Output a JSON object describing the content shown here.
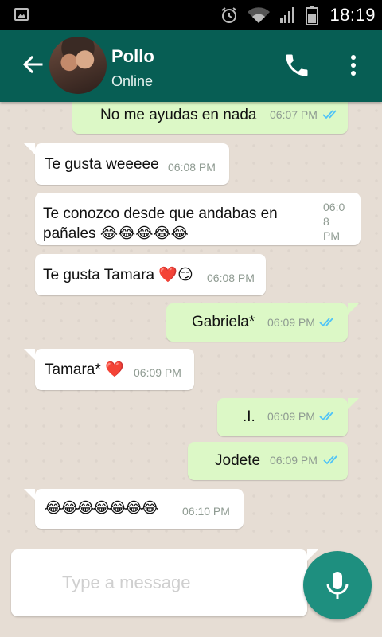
{
  "status_bar": {
    "time": "18:19",
    "icons": [
      "gallery-icon",
      "alarm-icon",
      "wifi-icon",
      "signal-icon",
      "battery-icon"
    ]
  },
  "header": {
    "name": "Pollo",
    "status": "Online",
    "icons": [
      "back-arrow-icon",
      "avatar",
      "phone-icon",
      "more-vert-icon"
    ]
  },
  "colors": {
    "header": "#075e54",
    "outgoing": "#dcf8c6",
    "incoming": "#ffffff",
    "ticks": "#4fc3f7",
    "fab": "#1e8f7f"
  },
  "messages": [
    {
      "dir": "out",
      "text": "No me ayudas en nada",
      "time": "06:07 PM",
      "read": true
    },
    {
      "dir": "in",
      "text": "Te gusta weeeee",
      "time": "06:08 PM"
    },
    {
      "dir": "in",
      "text_line1": "Te conozco desde que andabas en",
      "text_line2": "pañales 😂😂😂😂😂",
      "time_line1": "06:0",
      "time_line2": "8",
      "time_line3": "PM"
    },
    {
      "dir": "in",
      "text": "Te gusta Tamara ❤️😏",
      "time": "06:08 PM"
    },
    {
      "dir": "out",
      "text": "Gabriela*",
      "time": "06:09 PM",
      "read": true
    },
    {
      "dir": "in",
      "text": "Tamara* ❤️",
      "time": "06:09 PM"
    },
    {
      "dir": "out",
      "text": ".I.",
      "time": "06:09 PM",
      "read": true
    },
    {
      "dir": "out",
      "text": "Jodete",
      "time": "06:09 PM",
      "read": true
    },
    {
      "dir": "in",
      "text": "😂😂😂😂😂😂😂",
      "time": "06:10 PM"
    }
  ],
  "composer": {
    "placeholder": "Type a message",
    "value": ""
  }
}
